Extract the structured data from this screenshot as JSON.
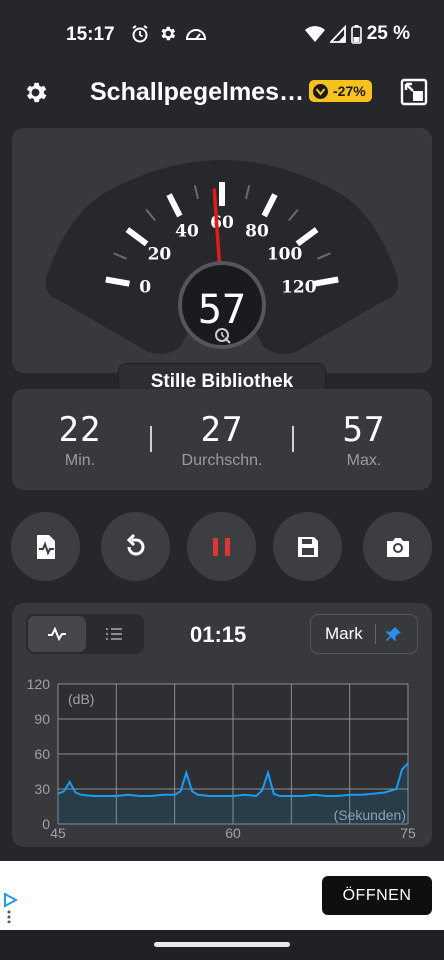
{
  "status": {
    "time": "15:17",
    "battery": "25 %"
  },
  "app": {
    "title": "Schallpegelmes…",
    "badge_pct": "-27%"
  },
  "gauge": {
    "ticks": [
      "0",
      "20",
      "40",
      "60",
      "80",
      "100",
      "120"
    ],
    "value": "57",
    "needle_db": 57,
    "preset": "Stille Bibliothek"
  },
  "stats": {
    "min": {
      "value": "22",
      "label": "Min."
    },
    "avg": {
      "value": "27",
      "label": "Durchschn."
    },
    "max": {
      "value": "57",
      "label": "Max."
    }
  },
  "controls": [
    "record-report",
    "reset",
    "pause",
    "save",
    "camera"
  ],
  "chart_header": {
    "timer": "01:15",
    "mark_label": "Mark"
  },
  "chart_data": {
    "type": "line",
    "unit_label": "(dB)",
    "x_unit_label": "(Sekunden)",
    "y_ticks": [
      "120",
      "90",
      "60",
      "30",
      "0"
    ],
    "x_ticks": [
      "45",
      "60",
      "75"
    ],
    "xlim": [
      45,
      75
    ],
    "ylim": [
      0,
      120
    ],
    "grid": true,
    "series": [
      {
        "x": [
          45,
          45.5,
          46,
          46.5,
          47,
          48,
          49,
          50,
          51,
          52,
          53,
          54,
          55,
          55.5,
          56,
          56.5,
          57,
          58,
          59,
          60,
          61,
          62,
          62.5,
          63,
          63.5,
          64,
          65,
          66,
          67,
          68,
          69,
          70,
          71,
          72,
          73,
          74,
          74.5,
          75
        ],
        "values": [
          26,
          28,
          36,
          27,
          25,
          24,
          24,
          24,
          25,
          24,
          24,
          25,
          25,
          28,
          44,
          28,
          25,
          24,
          24,
          24,
          25,
          24,
          29,
          44,
          26,
          24,
          24,
          24,
          25,
          24,
          24,
          25,
          25,
          26,
          27,
          30,
          47,
          52
        ]
      }
    ],
    "color": "#1a9cf0"
  },
  "ad": {
    "button": "ÖFFNEN"
  }
}
